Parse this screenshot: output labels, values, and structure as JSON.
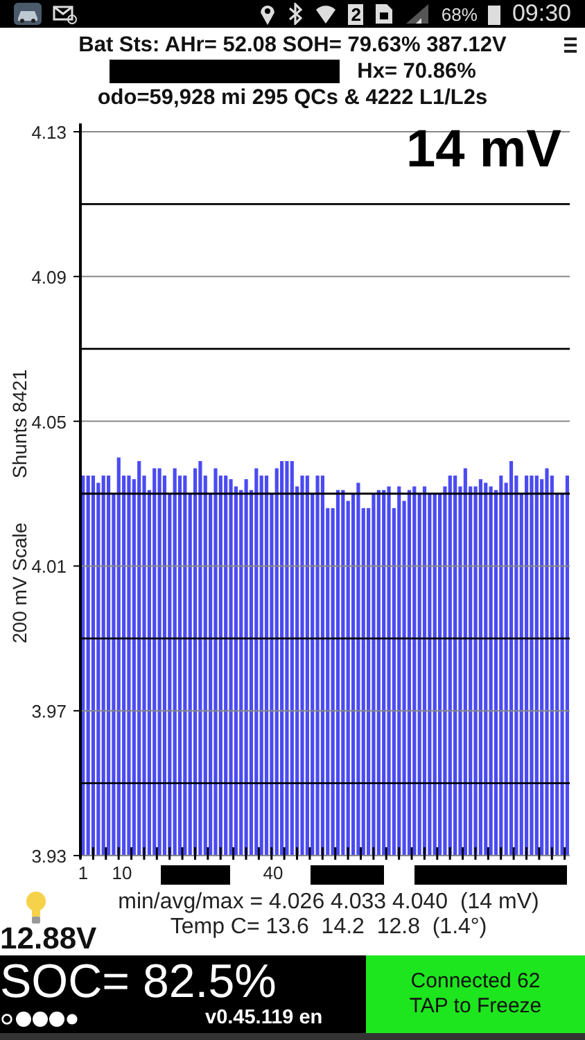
{
  "status_bar": {
    "sim_slot": "2",
    "battery": "68%",
    "time": "09:30"
  },
  "header": {
    "line_1": "Bat Sts: AHr= 52.08 SOH= 79.63% 387.12V",
    "hx": "Hx= 70.86%",
    "line_3": "odo=59,928 mi 295 QCs & 4222 L1/L2s"
  },
  "chart": {
    "spread": "14 mV",
    "x_labels": [
      "1",
      "10",
      "40"
    ],
    "shunts_label": "Shunts 8421",
    "chart_data": {
      "type": "bar",
      "ylabel": "200 mV Scale",
      "ylim": [
        3.93,
        4.13
      ],
      "yticks": [
        3.93,
        3.97,
        4.01,
        4.05,
        4.09,
        4.13
      ],
      "grid": true,
      "values": [
        4.035,
        4.035,
        4.035,
        4.033,
        4.035,
        4.035,
        4.03,
        4.04,
        4.035,
        4.035,
        4.034,
        4.039,
        4.035,
        4.031,
        4.037,
        4.037,
        4.035,
        4.03,
        4.037,
        4.035,
        4.035,
        4.03,
        4.037,
        4.039,
        4.035,
        4.03,
        4.037,
        4.035,
        4.035,
        4.034,
        4.032,
        4.031,
        4.034,
        4.031,
        4.037,
        4.035,
        4.035,
        4.03,
        4.037,
        4.039,
        4.039,
        4.039,
        4.032,
        4.035,
        4.035,
        4.03,
        4.035,
        4.035,
        4.026,
        4.026,
        4.031,
        4.031,
        4.028,
        4.03,
        4.033,
        4.026,
        4.026,
        4.03,
        4.031,
        4.031,
        4.032,
        4.026,
        4.032,
        4.028,
        4.031,
        4.032,
        4.03,
        4.032,
        4.03,
        4.03,
        4.03,
        4.032,
        4.035,
        4.035,
        4.032,
        4.037,
        4.032,
        4.032,
        4.034,
        4.033,
        4.032,
        4.031,
        4.035,
        4.033,
        4.039,
        4.035,
        4.03,
        4.035,
        4.035,
        4.035,
        4.034,
        4.037,
        4.035,
        4.03,
        4.03,
        4.035
      ]
    }
  },
  "stats": {
    "aux_voltage": "12.88V",
    "min_avg_max": "min/avg/max = 4.026 4.033 4.040  (14 mV)",
    "temp": "Temp C= 13.6  14.2  12.8  (1.4°)"
  },
  "footer": {
    "soc": "SOC= 82.5%",
    "version": "v0.45.119 en",
    "connection": "Connected 62",
    "action": "TAP to Freeze"
  }
}
